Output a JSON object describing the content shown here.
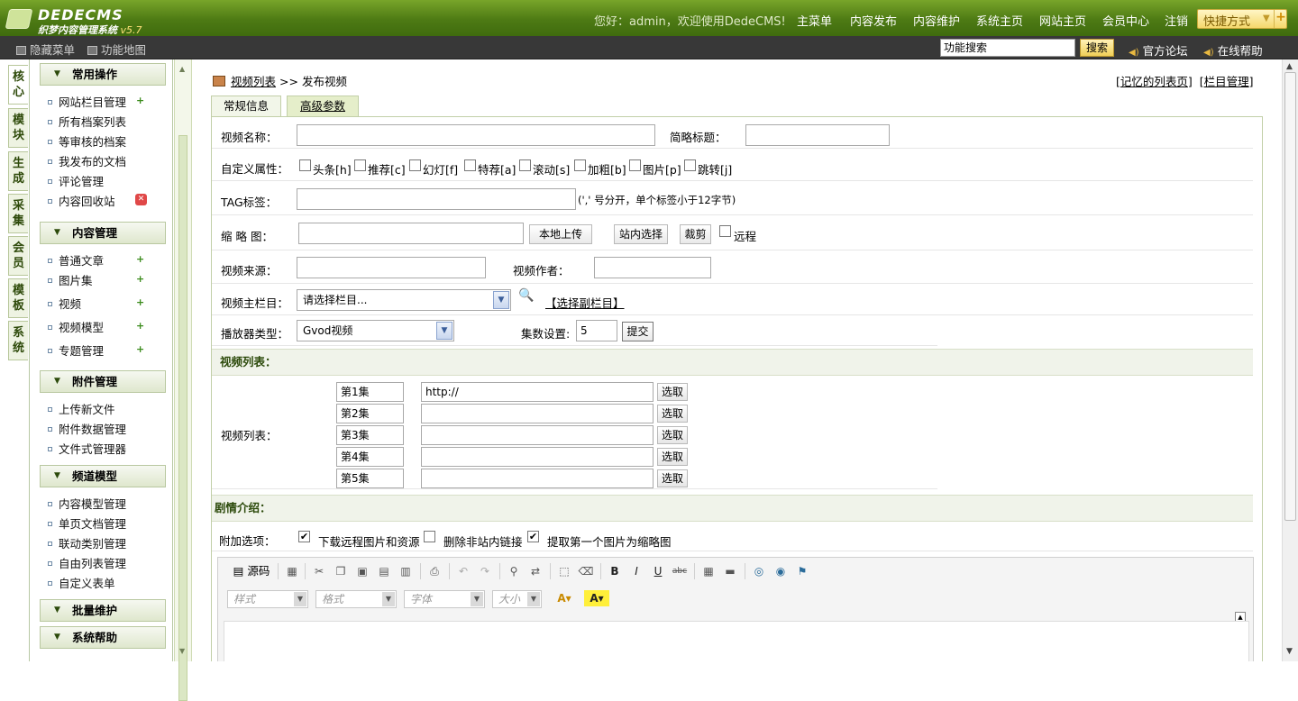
{
  "header": {
    "brand": "DEDECMS",
    "subtitle": "织梦内容管理系统",
    "version": "v5.7",
    "welcome": "您好：admin，欢迎使用DedeCMS!",
    "nav": [
      "主菜单",
      "内容发布",
      "内容维护",
      "系统主页",
      "网站主页",
      "会员中心",
      "注销"
    ],
    "quick": "快捷方式"
  },
  "subbar": {
    "hide_menu": "隐藏菜单",
    "site_map": "功能地图",
    "search_value": "功能搜索",
    "search_btn": "搜索",
    "forum": "官方论坛",
    "help": "在线帮助"
  },
  "left_tabs": [
    "核心",
    "模块",
    "生成",
    "采集",
    "会员",
    "模板",
    "系统"
  ],
  "menu": {
    "sec1": "常用操作",
    "sec1_items": [
      "网站栏目管理",
      "所有档案列表",
      "等审核的档案",
      "我发布的文档",
      "评论管理",
      "内容回收站"
    ],
    "sec2": "内容管理",
    "sec2_items": [
      "普通文章",
      "图片集",
      "视频",
      "视频模型",
      "专题管理"
    ],
    "sec3": "附件管理",
    "sec3_items": [
      "上传新文件",
      "附件数据管理",
      "文件式管理器"
    ],
    "sec4": "频道模型",
    "sec4_items": [
      "内容模型管理",
      "单页文档管理",
      "联动类别管理",
      "自由列表管理",
      "自定义表单"
    ],
    "sec5": "批量维护",
    "sec6": "系统帮助"
  },
  "crumb": {
    "list": "视频列表",
    "sep": ">>",
    "current": "发布视频"
  },
  "top_links": {
    "remember": "记忆的列表页",
    "cat_manage": "栏目管理"
  },
  "tabs": {
    "general": "常规信息",
    "advanced": "高级参数"
  },
  "form": {
    "title_label": "视频名称：",
    "short_title_label": "简略标题：",
    "attr_label": "自定义属性：",
    "attrs": [
      "头条[h]",
      "推荐[c]",
      "幻灯[f]",
      "特荐[a]",
      "滚动[s]",
      "加粗[b]",
      "图片[p]",
      "跳转[j]"
    ],
    "tag_label": "TAG标签：",
    "tag_hint": "(',' 号分开，单个标签小于12字节)",
    "thumb_label": "缩 略 图：",
    "upload_btn": "本地上传",
    "site_pick_btn": "站内选择",
    "crop_btn": "裁剪",
    "remote": "远程",
    "source_label": "视频来源：",
    "author_label": "视频作者：",
    "cat_label": "视频主栏目：",
    "cat_value": "请选择栏目...",
    "sub_cat": "【选择副栏目】",
    "player_label": "播放器类型：",
    "player_value": "Gvod视频",
    "episodes_label": "集数设置:",
    "episodes_value": "5",
    "submit_btn": "提交",
    "video_list_section": "视频列表：",
    "video_list_label": "视频列表：",
    "episodes": [
      {
        "name": "第1集",
        "url": "http://",
        "btn": "选取"
      },
      {
        "name": "第2集",
        "url": "",
        "btn": "选取"
      },
      {
        "name": "第3集",
        "url": "",
        "btn": "选取"
      },
      {
        "name": "第4集",
        "url": "",
        "btn": "选取"
      },
      {
        "name": "第5集",
        "url": "",
        "btn": "选取"
      }
    ],
    "plot_section": "剧情介绍：",
    "extra_label": "附加选项：",
    "extra_opts": [
      "下载远程图片和资源",
      "删除非站内链接",
      "提取第一个图片为缩略图"
    ],
    "extra_checked": [
      true,
      false,
      true
    ]
  },
  "editor": {
    "source": "源码",
    "style_ph": "样式",
    "format_ph": "格式",
    "font_ph": "字体",
    "size_ph": "大小"
  }
}
